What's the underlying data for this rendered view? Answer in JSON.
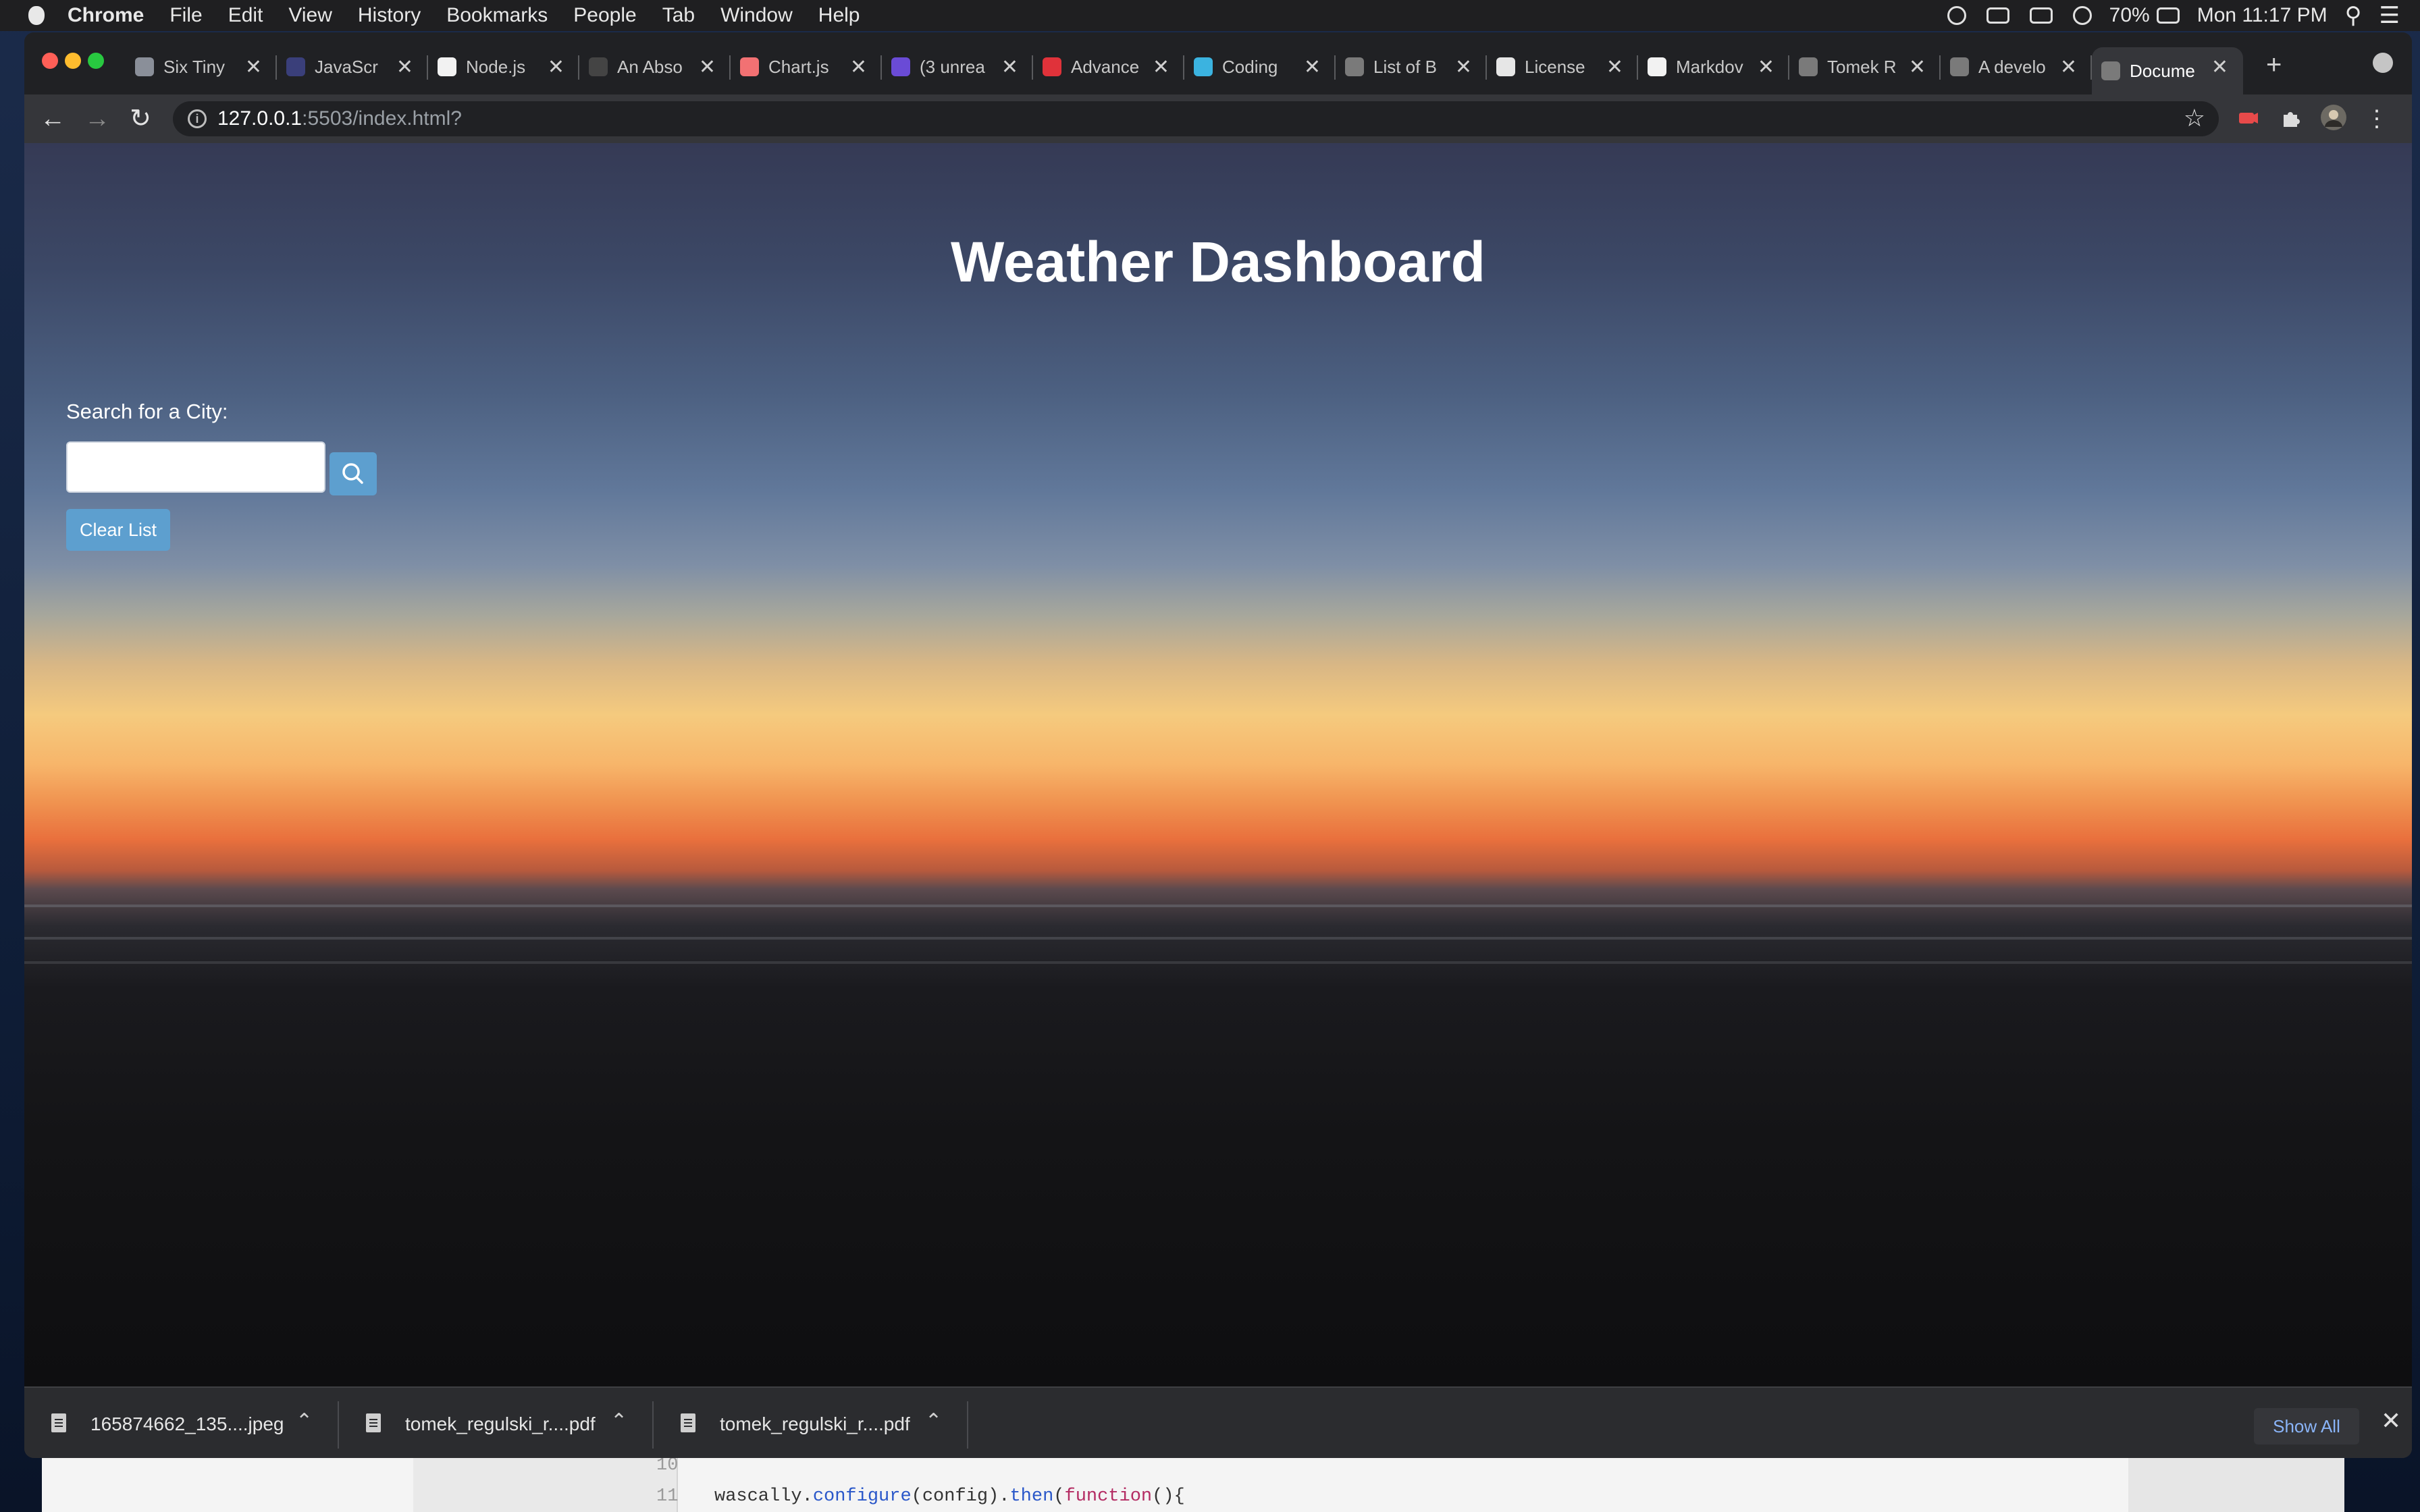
{
  "menubar": {
    "app": "Chrome",
    "items": [
      "File",
      "Edit",
      "View",
      "History",
      "Bookmarks",
      "People",
      "Tab",
      "Window",
      "Help"
    ],
    "battery": "70%",
    "clock": "Mon 11:17 PM"
  },
  "tabs": [
    {
      "label": "Six Tiny",
      "color": "#8a8f99"
    },
    {
      "label": "JavaScr",
      "color": "#3a3f7a"
    },
    {
      "label": "Node.js",
      "color": "#f2f2f2"
    },
    {
      "label": "An Abso",
      "color": "#444444"
    },
    {
      "label": "Chart.js",
      "color": "#f27173"
    },
    {
      "label": "(3 unrea",
      "color": "#6a4bd6"
    },
    {
      "label": "Advance",
      "color": "#e0323a"
    },
    {
      "label": "Coding",
      "color": "#3bb3e0"
    },
    {
      "label": "List of B",
      "color": "#7a7a7a"
    },
    {
      "label": "License",
      "color": "#e6e6e6"
    },
    {
      "label": "Markdov",
      "color": "#f2f2f2"
    },
    {
      "label": "Tomek R",
      "color": "#7a7a7a"
    },
    {
      "label": "A develo",
      "color": "#7a7a7a"
    },
    {
      "label": "Docume",
      "color": "#7a7a7a",
      "active": true
    }
  ],
  "address": {
    "host": "127.0.0.1",
    "rest": ":5503/index.html?"
  },
  "page": {
    "title": "Weather Dashboard",
    "search_label": "Search for a City:",
    "search_value": "",
    "clear_label": "Clear List"
  },
  "downloads": {
    "items": [
      "165874662_135....jpeg",
      "tomek_regulski_r....pdf",
      "tomek_regulski_r....pdf"
    ],
    "show_all": "Show All"
  },
  "background_code": {
    "line_10": "10",
    "line_11": "11",
    "code_prefix": "wascally.",
    "code_fn1": "configure",
    "code_mid": "(config).",
    "code_fn2": "then",
    "code_paren": "(",
    "code_kw": "function",
    "code_suffix": "(){"
  },
  "colors": {
    "accent_button": "#5d9fcf",
    "link_blue": "#8ab4f8"
  }
}
